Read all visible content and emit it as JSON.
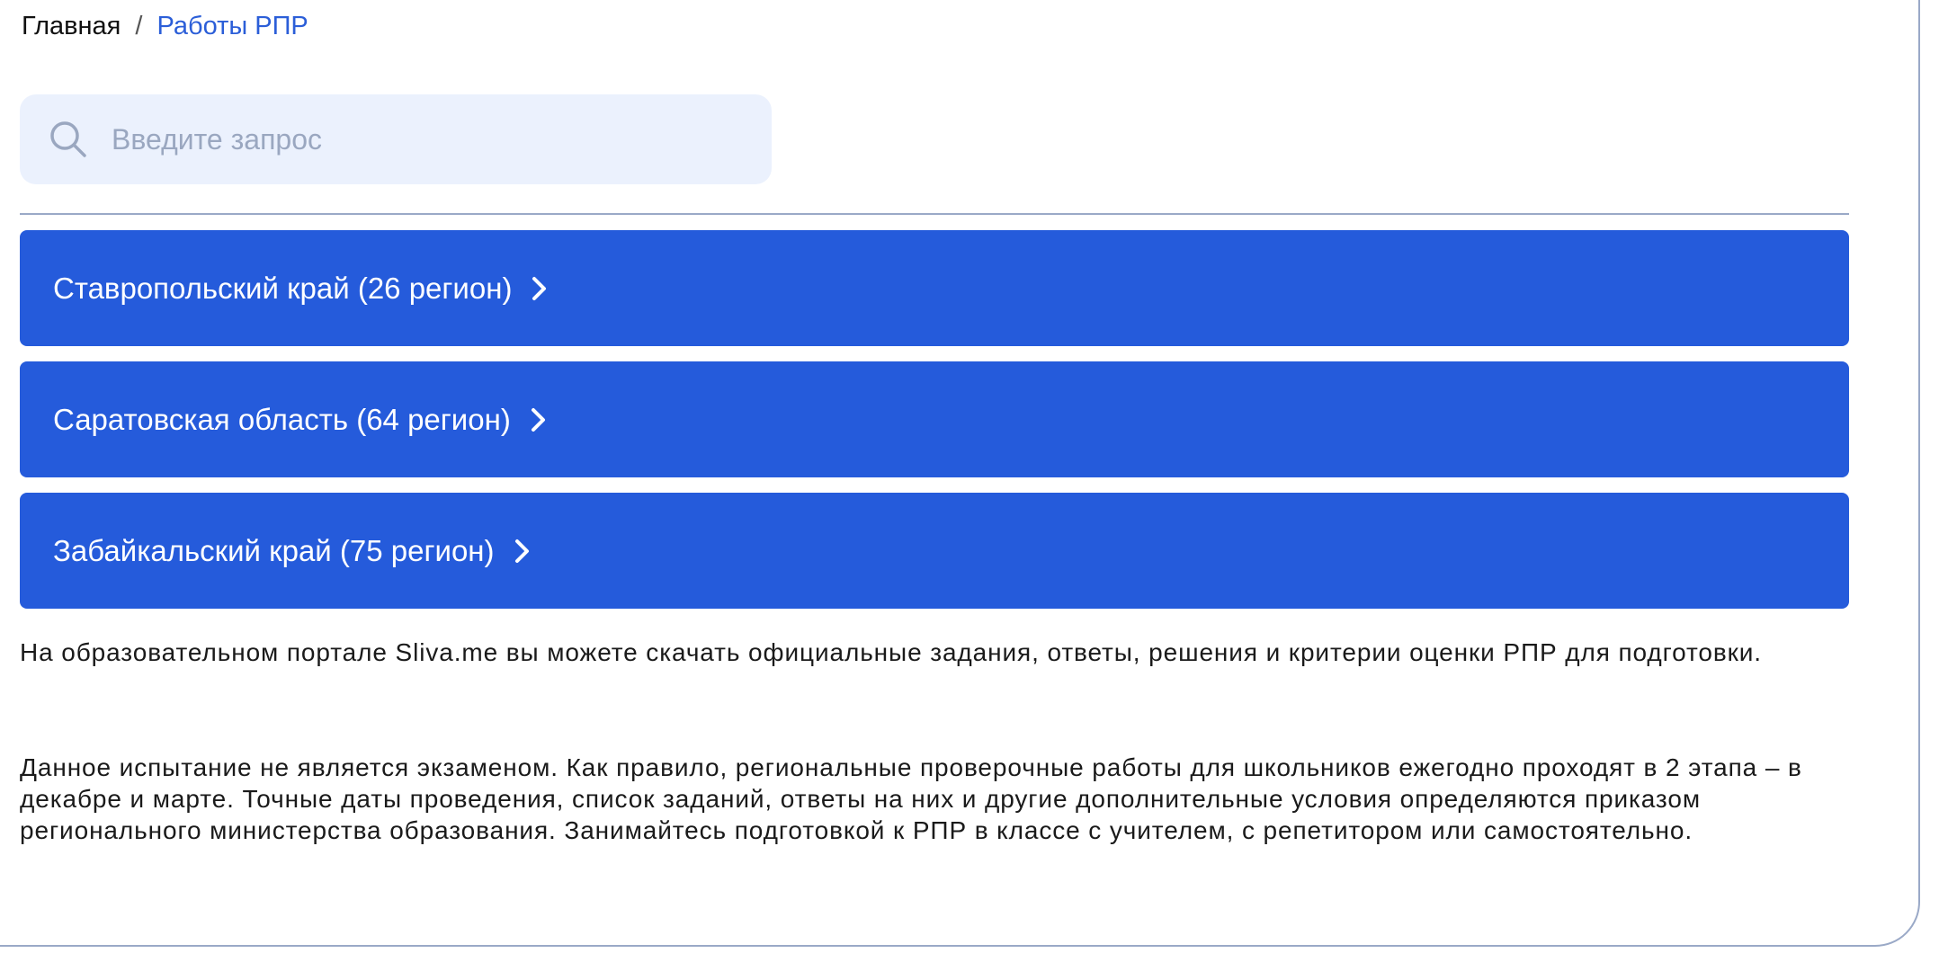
{
  "breadcrumb": {
    "home": "Главная",
    "separator": "/",
    "current": "Работы РПР"
  },
  "search": {
    "placeholder": "Введите запрос",
    "icon": "search-icon"
  },
  "regions": [
    {
      "label": "Ставропольский край (26 регион)"
    },
    {
      "label": "Саратовская область (64 регион)"
    },
    {
      "label": "Забайкальский край (75 регион)"
    }
  ],
  "description": {
    "p1": "На образовательном портале Sliva.me вы можете скачать официальные задания, ответы, решения и критерии оценки РПР для подготовки.",
    "p2": "Данное испытание не является экзаменом. Как правило, региональные проверочные работы для школьников ежегодно проходят в 2 этапа – в декабре и марте. Точные даты проведения, список заданий, ответы на них и другие дополнительные условия определяются приказом регионального министерства образования. Занимайтесь подготовкой к РПР в классе с учителем, с репетитором или самостоятельно."
  },
  "colors": {
    "accent": "#255bdb",
    "link": "#2b5ed8",
    "search_bg": "#ebf1fd",
    "border": "#9aa9c7"
  }
}
